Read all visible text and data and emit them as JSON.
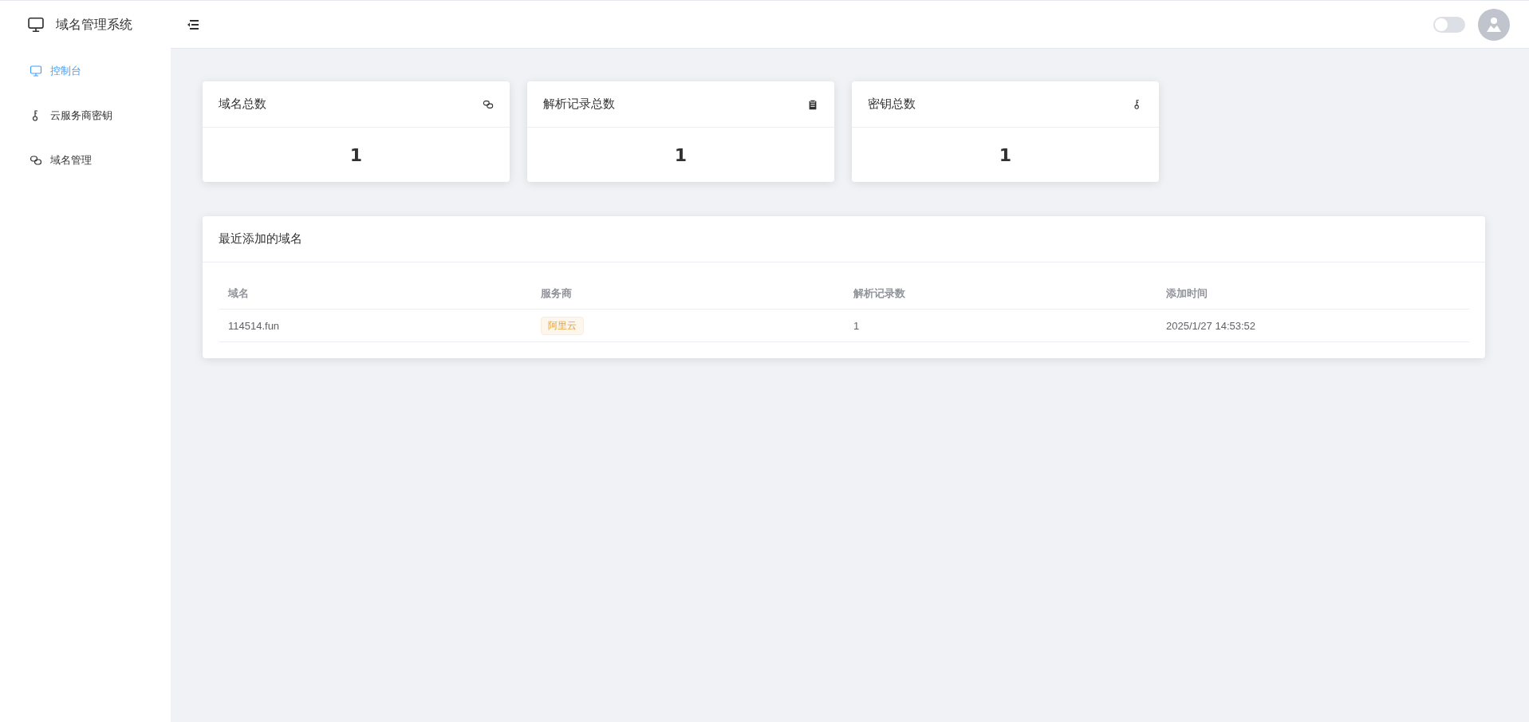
{
  "sidebar": {
    "title": "域名管理系统",
    "items": [
      {
        "label": "控制台",
        "kind": "monitor",
        "selected": true
      },
      {
        "label": "云服务商密钥",
        "kind": "key",
        "selected": false
      },
      {
        "label": "域名管理",
        "kind": "link",
        "selected": false
      }
    ]
  },
  "header": {
    "theme_switch": {
      "on": false
    }
  },
  "stats": [
    {
      "title": "域名总数",
      "kind": "link",
      "value": "1"
    },
    {
      "title": "解析记录总数",
      "kind": "clipboard",
      "value": "1"
    },
    {
      "title": "密钥总数",
      "kind": "key",
      "value": "1"
    }
  ],
  "recent": {
    "title": "最近添加的域名",
    "columns": [
      "域名",
      "服务商",
      "解析记录数",
      "添加时间"
    ],
    "rows": [
      {
        "domain": "114514.fun",
        "provider": "阿里云",
        "records": "1",
        "added": "2025/1/27 14:53:52"
      }
    ]
  }
}
